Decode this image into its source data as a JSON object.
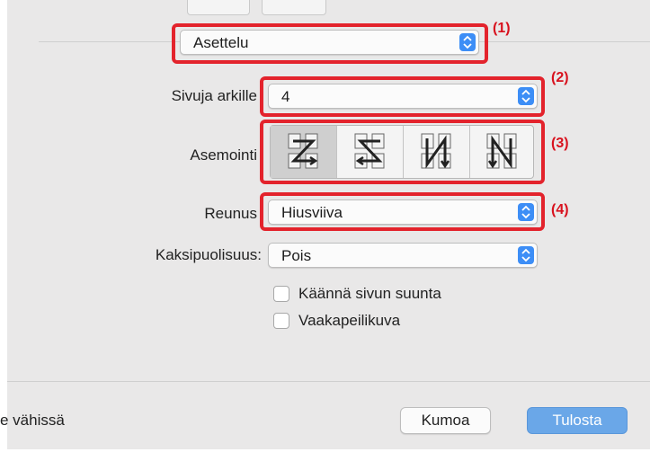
{
  "layout_menu": {
    "value": "Asettelu",
    "marker": "(1)"
  },
  "pages_per_sheet": {
    "label": "Sivuja arkille",
    "value": "4",
    "marker": "(2)"
  },
  "layout_direction": {
    "label": "Asemointi",
    "marker": "(3)",
    "options": [
      {
        "icon": "z-layout-right-then-down-icon",
        "selected": true
      },
      {
        "icon": "reverse-z-layout-left-then-down-icon",
        "selected": false
      },
      {
        "icon": "n-layout-down-then-right-icon",
        "selected": false
      },
      {
        "icon": "reverse-n-layout-down-then-left-icon",
        "selected": false
      }
    ]
  },
  "border": {
    "label": "Reunus",
    "value": "Hiusviiva",
    "marker": "(4)"
  },
  "two_sided": {
    "label": "Kaksipuolisuus:",
    "value": "Pois"
  },
  "checkboxes": [
    {
      "label": "Käännä sivun suunta",
      "checked": false
    },
    {
      "label": "Vaakapeilikuva",
      "checked": false
    }
  ],
  "footer": {
    "left_text": "e vähissä",
    "cancel_label": "Kumoa",
    "print_label": "Tulosta"
  },
  "colors": {
    "highlight": "#e3232c",
    "stepper": "#3d8ef6",
    "primary_button": "#6aa7e8",
    "panel": "#e9e8e8"
  }
}
